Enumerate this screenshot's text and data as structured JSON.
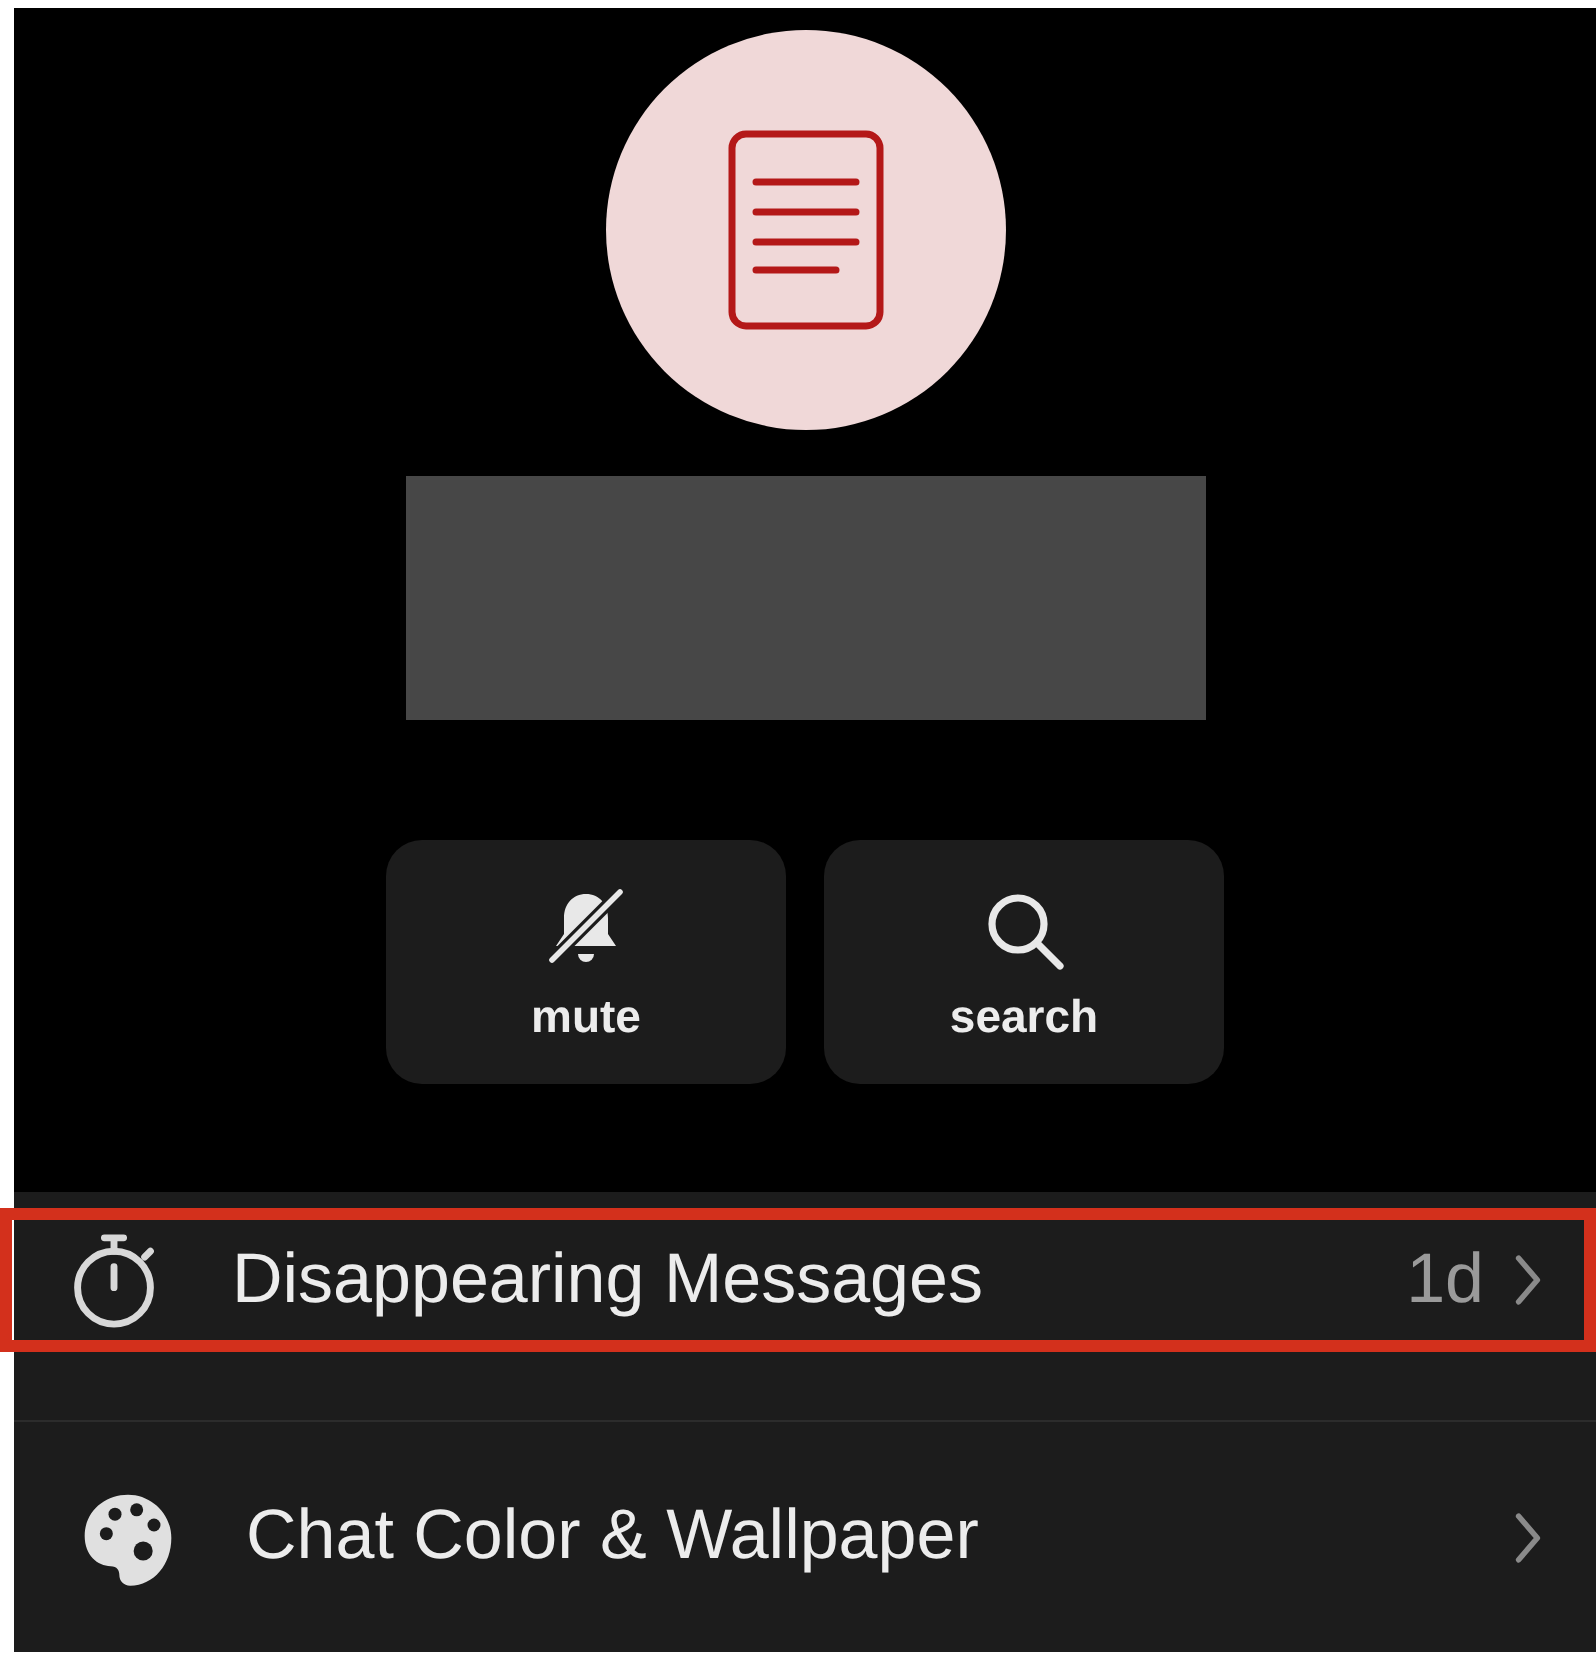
{
  "actions": [
    {
      "kind": "mute",
      "label": "mute"
    },
    {
      "kind": "search",
      "label": "search"
    }
  ],
  "rows": [
    {
      "kind": "timer",
      "label": "Disappearing Messages",
      "value": "1d",
      "highlighted": true
    },
    {
      "kind": "palette",
      "label": "Chat Color & Wallpaper",
      "highlighted": false
    }
  ]
}
